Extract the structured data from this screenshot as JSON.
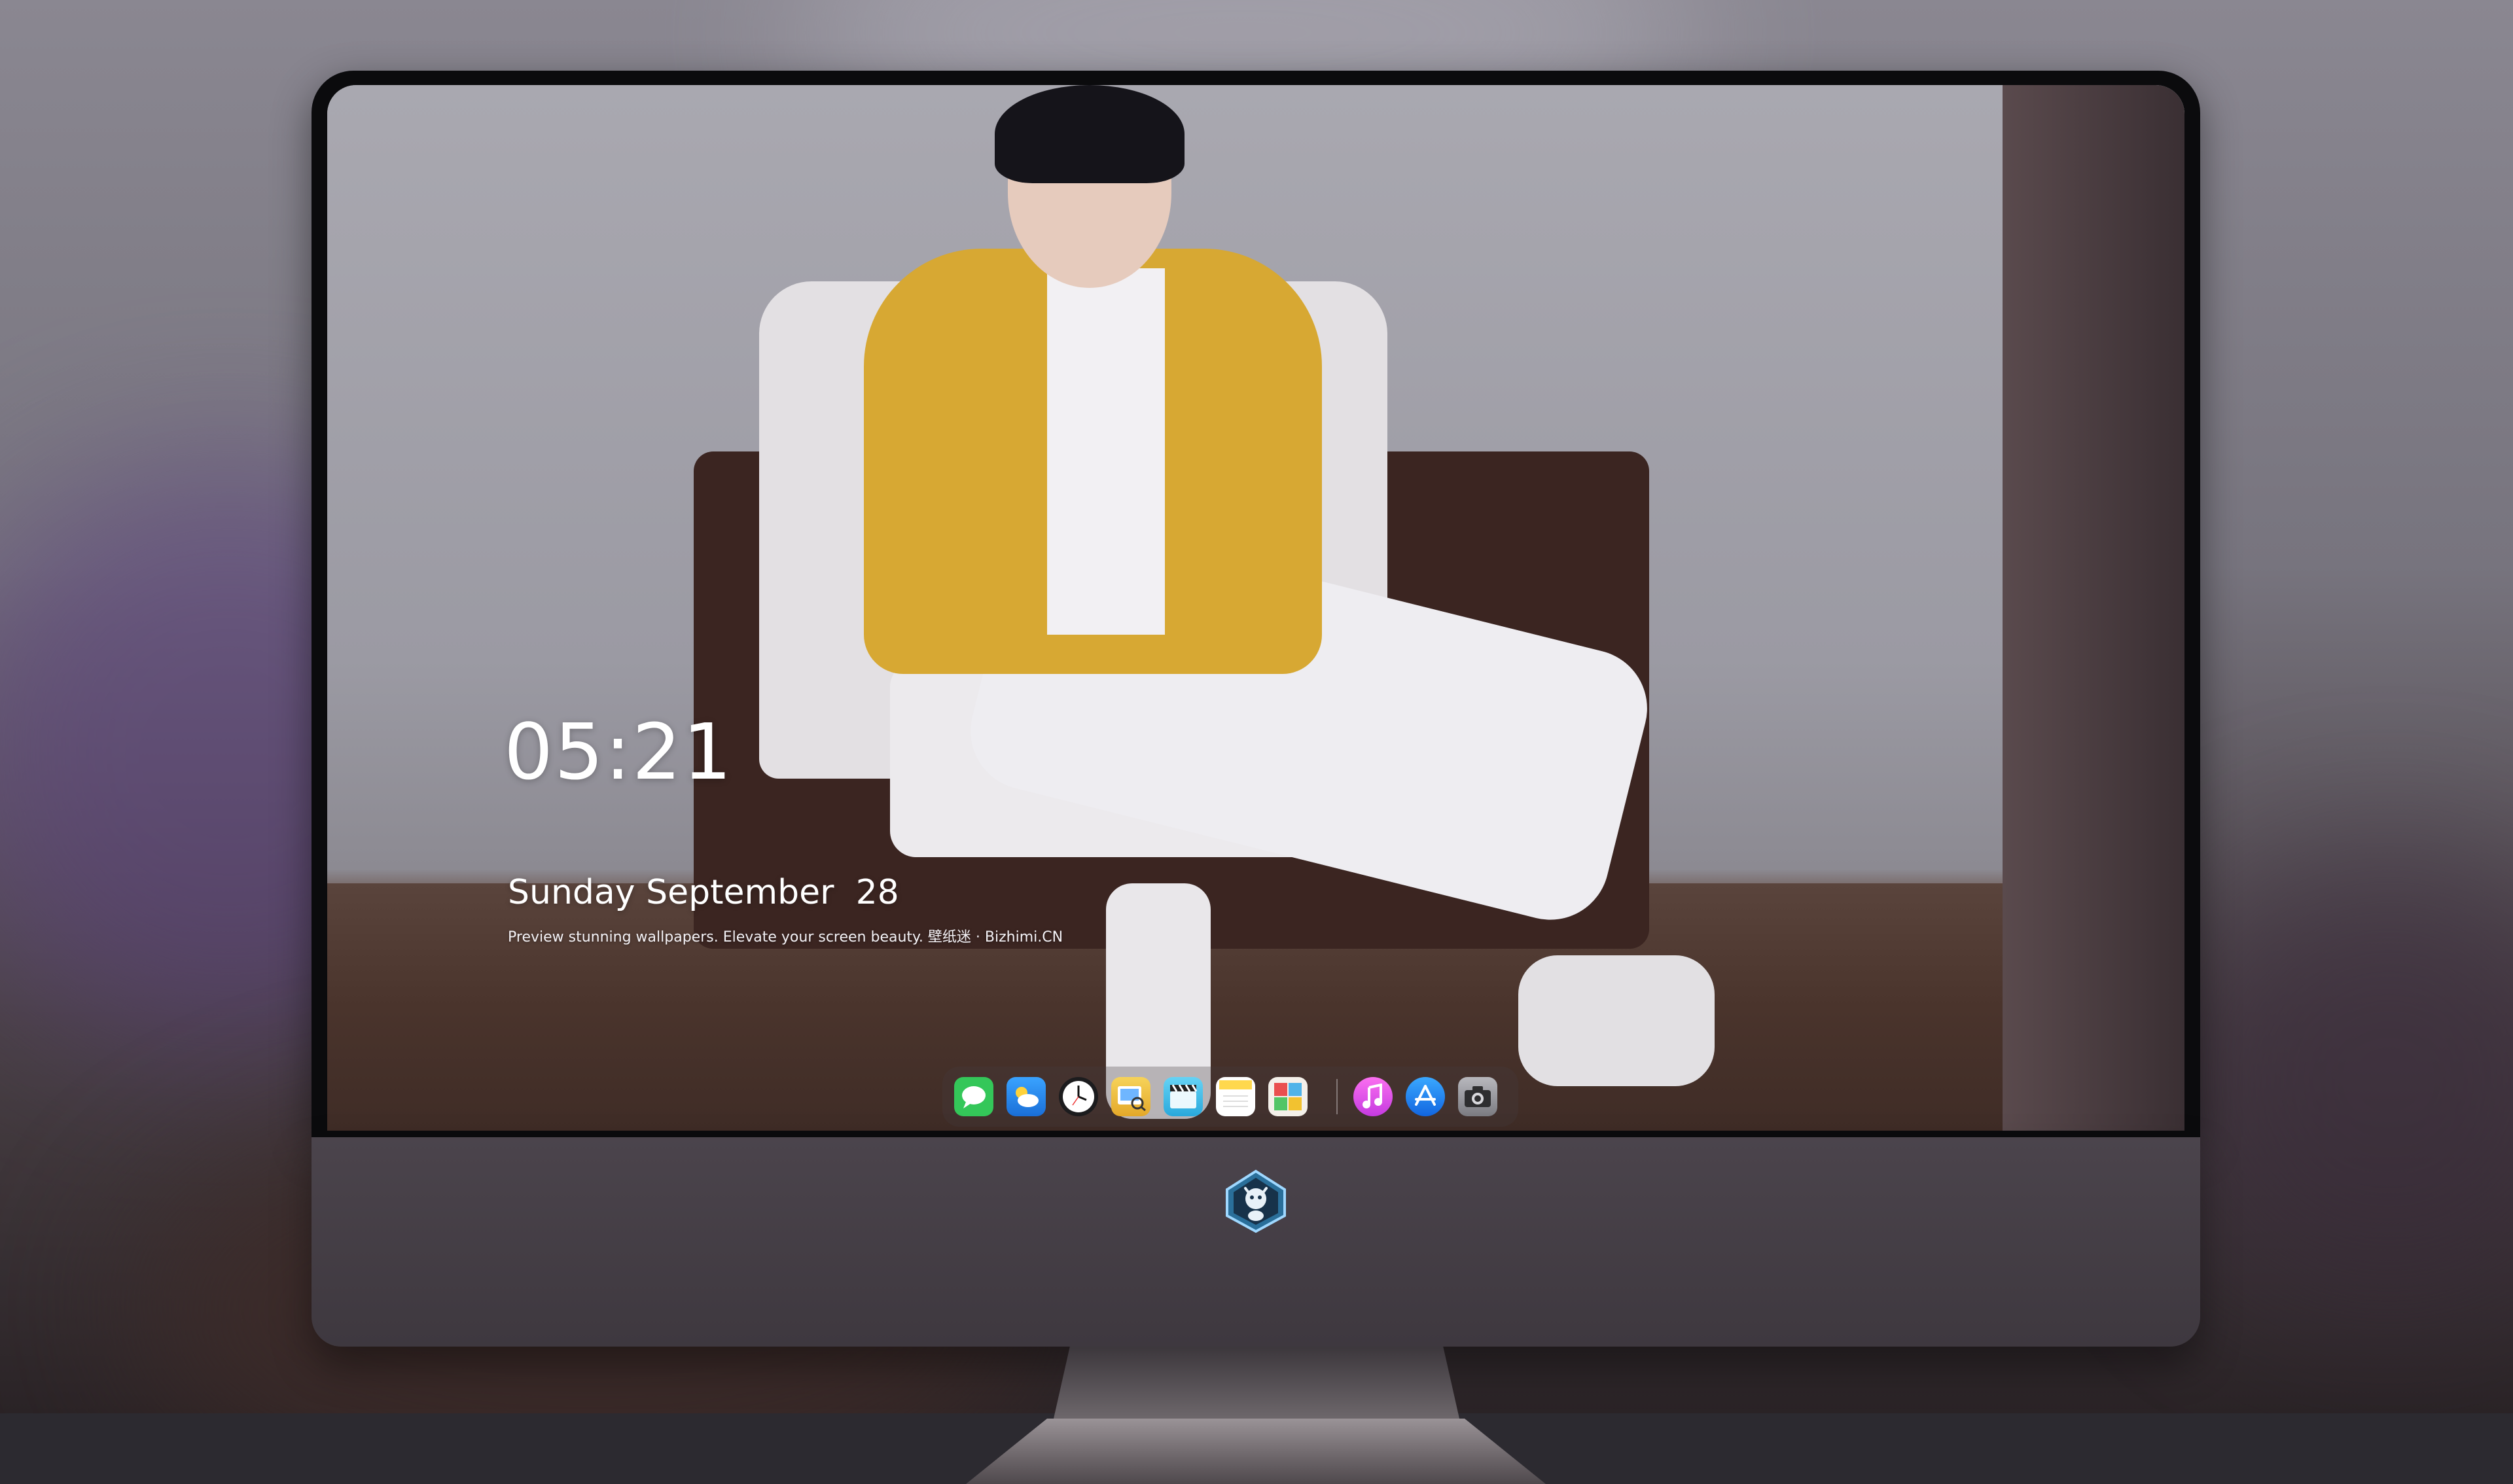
{
  "lockscreen": {
    "time": "05:21",
    "date": "Sunday September  28",
    "tagline": "Preview stunning wallpapers. Elevate your screen beauty. 壁纸迷 · Bizhimi.CN"
  },
  "dock": {
    "apps": [
      {
        "name": "Messages",
        "icon": "messages-icon",
        "color": "#34c759"
      },
      {
        "name": "Weather",
        "icon": "weather-icon",
        "color": "#2f8ff0"
      },
      {
        "name": "Clock",
        "icon": "clock-icon",
        "color": "#ffffff"
      },
      {
        "name": "Preview",
        "icon": "preview-icon",
        "color": "#f1c33b"
      },
      {
        "name": "Clips",
        "icon": "clips-icon",
        "color": "#5ac8fa"
      },
      {
        "name": "Notes",
        "icon": "notes-icon",
        "color": "#ffd84d"
      },
      {
        "name": "Photo Booth",
        "icon": "photo-booth-icon",
        "color": "#e94f4f"
      },
      {
        "name": "iTunes",
        "icon": "itunes-icon",
        "color": "#f05ad8"
      },
      {
        "name": "App Store",
        "icon": "app-store-icon",
        "color": "#1e90ff"
      },
      {
        "name": "Camera",
        "icon": "camera-icon",
        "color": "#8e8e93"
      }
    ]
  },
  "device": {
    "logo_icon": "dragon-mascot-icon"
  }
}
